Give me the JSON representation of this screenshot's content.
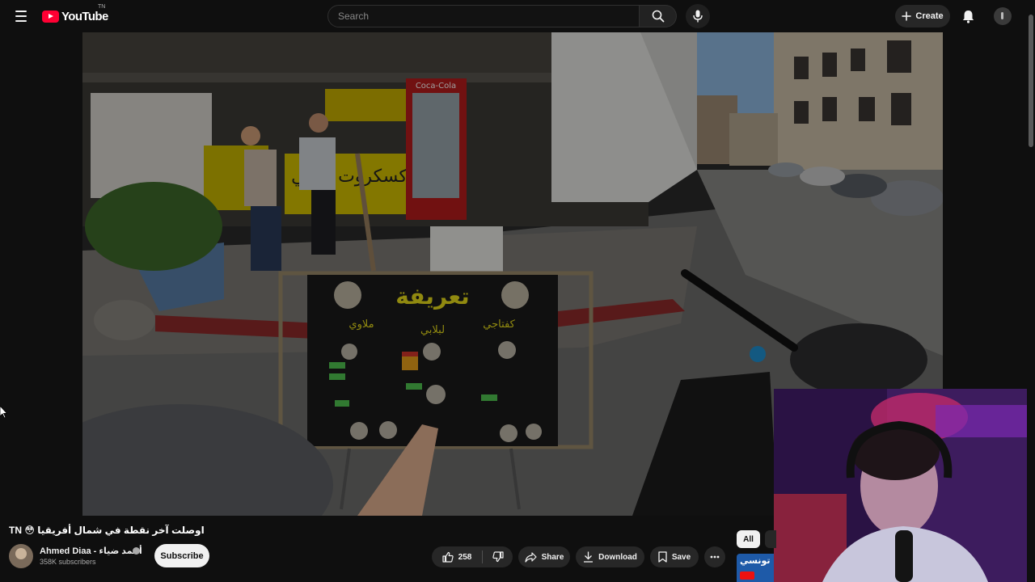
{
  "header": {
    "logo_text": "YouTube",
    "logo_region": "TN",
    "search_placeholder": "Search",
    "create_label": "Create"
  },
  "video": {
    "title": "TN 😳 اوصلت آخر نقطة في شمال أفريقيا",
    "sign_title": "تعريفة",
    "sign_columns": [
      "ملاوي",
      "لبلابي",
      "كفتاجي"
    ],
    "shop_sign_text": "كسكروت لبلابي",
    "coca_cola_text": "Coca-Cola"
  },
  "channel": {
    "name": "Ahmed Diaa - أحمد ضياء",
    "subscribers": "358K subscribers",
    "subscribe_label": "Subscribe"
  },
  "actions": {
    "like_count": "258",
    "share_label": "Share",
    "download_label": "Download",
    "save_label": "Save"
  },
  "sidebar": {
    "chip_all": "All",
    "next_thumb_text": "تونسي"
  },
  "icons": {
    "menu": "menu-icon",
    "search": "search-icon",
    "mic": "mic-icon",
    "plus": "plus-icon",
    "bell": "bell-icon",
    "like": "thumbs-up-icon",
    "dislike": "thumbs-down-icon",
    "share": "share-arrow-icon",
    "download": "download-icon",
    "save": "bookmark-icon",
    "more": "more-horizontal-icon",
    "verified": "verified-icon"
  },
  "colors": {
    "background": "#0f0f0f",
    "brand_red": "#ff0033",
    "pill": "#272727",
    "sky": "#8fb8e0",
    "webcam_purple": "#3a1a52"
  }
}
